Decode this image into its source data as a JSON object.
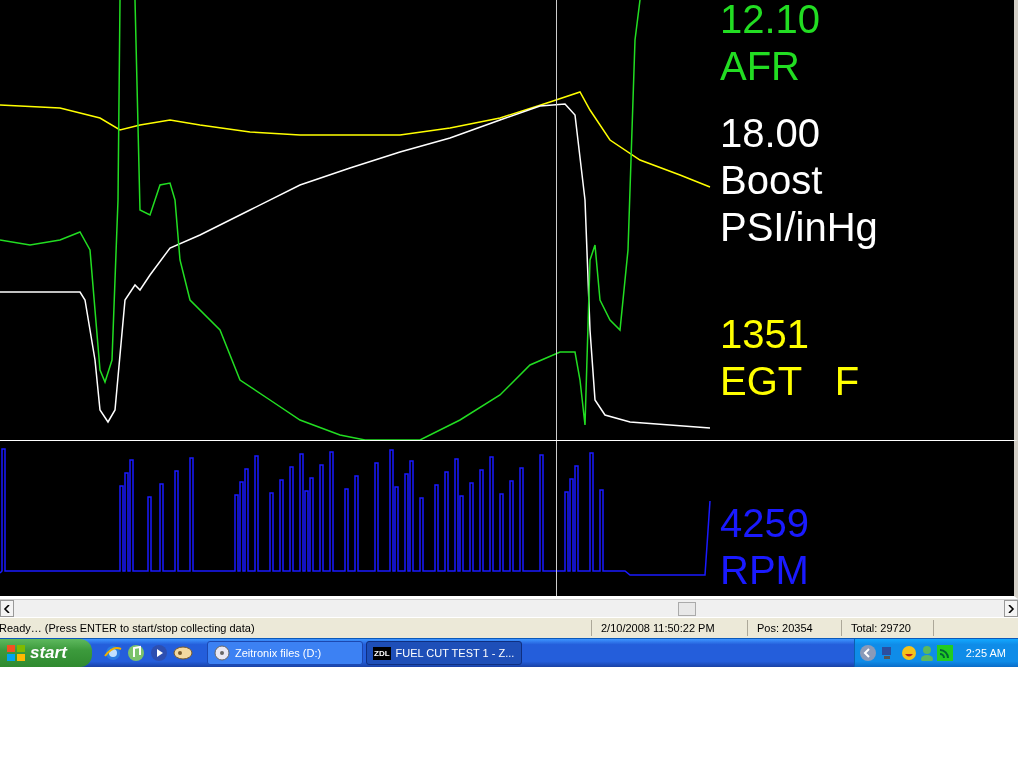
{
  "upper_panel": {
    "readings": [
      {
        "value": "12.10",
        "lines": [
          "AFR"
        ],
        "color": "#22dd22"
      },
      {
        "value": "18.00",
        "lines": [
          "Boost",
          "PSI/inHg"
        ],
        "color": "#ffffff"
      },
      {
        "value": "1351",
        "lines": [
          "EGT   F"
        ],
        "color": "#ffff00"
      }
    ]
  },
  "lower_panel": {
    "readings": [
      {
        "value": "4259",
        "lines": [
          "RPM"
        ],
        "color": "#1a1aff"
      }
    ]
  },
  "status_bar": {
    "message": "Ready… (Press ENTER to start/stop collecting data)",
    "timestamp": "2/10/2008 11:50:22 PM",
    "position": "Pos: 20354",
    "total": "Total: 29720"
  },
  "taskbar": {
    "start_label": "start",
    "tasks": [
      {
        "label": "Zeitronix files (D:)",
        "selected": false
      },
      {
        "label": "FUEL CUT TEST 1 - Z...",
        "icon_text": "ZDL",
        "selected": true
      }
    ],
    "clock": "2:25 AM"
  }
}
